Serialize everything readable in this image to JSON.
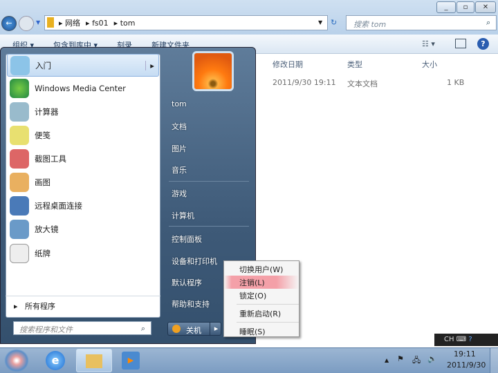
{
  "window": {
    "buttons": [
      "minimize",
      "maximize",
      "close"
    ]
  },
  "address": {
    "segments": [
      "网络",
      "fs01",
      "tom"
    ]
  },
  "search": {
    "placeholder": "搜索 tom"
  },
  "toolbar": {
    "items": [
      "组织 ▾",
      "包含到库中 ▾",
      "刻录",
      "新建文件夹"
    ]
  },
  "columns": [
    "修改日期",
    "类型",
    "大小"
  ],
  "file": {
    "date": "2011/9/30 19:11",
    "type": "文本文档",
    "size": "1 KB"
  },
  "start": {
    "programs": [
      "入门",
      "Windows Media Center",
      "计算器",
      "便笺",
      "截图工具",
      "画图",
      "远程桌面连接",
      "放大镜",
      "纸牌"
    ],
    "all_programs": "所有程序",
    "search_placeholder": "搜索程序和文件",
    "right": [
      "tom",
      "文档",
      "图片",
      "音乐",
      "游戏",
      "计算机",
      "控制面板",
      "设备和打印机",
      "默认程序",
      "帮助和支持"
    ],
    "shutdown": "关机"
  },
  "power_menu": [
    "切换用户(W)",
    "注销(L)",
    "锁定(O)",
    "重新启动(R)",
    "睡眠(S)"
  ],
  "tray": {
    "ime": "CH",
    "time": "19:11",
    "date": "2011/9/30"
  },
  "colors": {
    "highlight": "#f4a0a8",
    "start_bg": "#3e5a78"
  }
}
